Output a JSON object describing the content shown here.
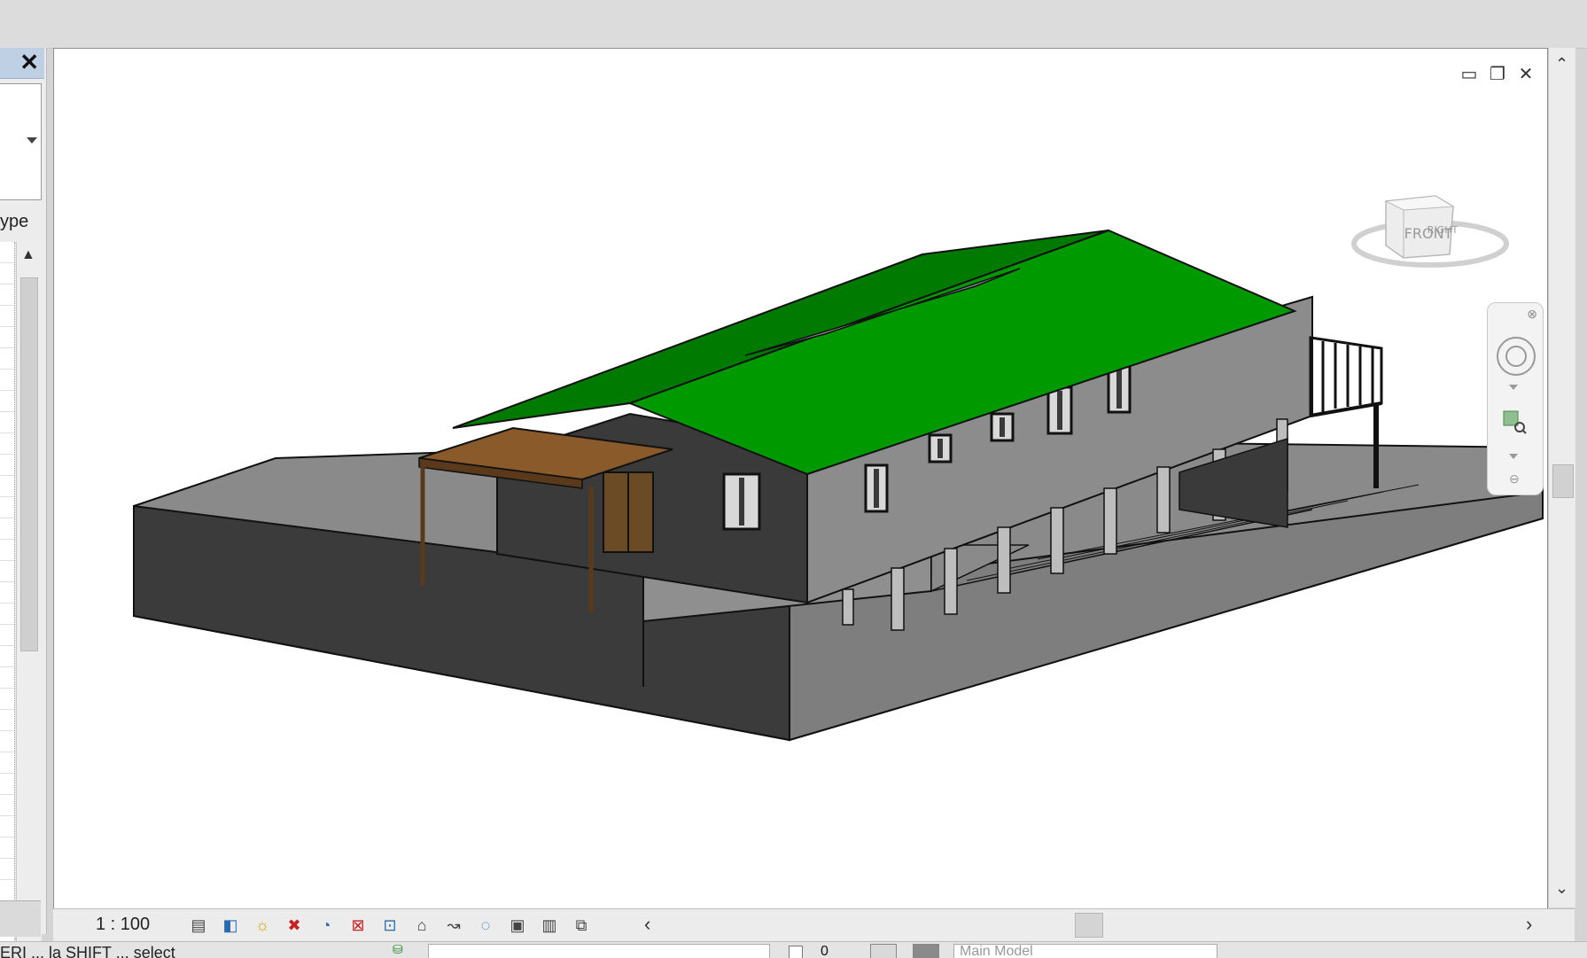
{
  "left_panel": {
    "close_label": "✕",
    "type_label": "ype"
  },
  "viewport": {
    "window_controls": [
      "▭",
      "❐",
      "✕"
    ],
    "viewcube": {
      "front_label": "FRONT",
      "right_label": "RIGHT"
    }
  },
  "view_control_bar": {
    "scale": "1 : 100",
    "icons": [
      "detail-level-icon",
      "visual-style-icon",
      "sun-path-icon",
      "shadows-off-icon",
      "show-rendering-icon",
      "crop-view-icon",
      "show-crop-region-icon",
      "unlock-3d-view-icon",
      "temporary-hide-icon",
      "reveal-hidden-icon",
      "temporary-view-properties-icon",
      "show-analytical-model-icon",
      "highlight-displacement-icon",
      "reveal-constraints-icon"
    ],
    "icon_glyphs": [
      "▤",
      "◧",
      "☼",
      "✖",
      "◔",
      "⊠",
      "⊡",
      "⌂",
      "↝",
      "◌",
      "▣",
      "▥",
      "⧉",
      "⊞"
    ]
  },
  "status_bar": {
    "text": "ERI ... la SHIFT ... select",
    "count": "0",
    "model": "Main Model"
  },
  "colors": {
    "roof": "#009a00",
    "awning": "#8b5a2b",
    "walls_light": "#8c8c8c",
    "walls_dark": "#3a3a3a"
  }
}
